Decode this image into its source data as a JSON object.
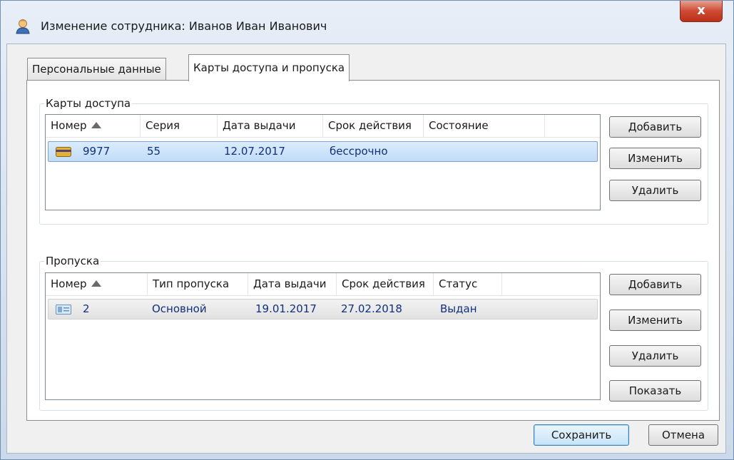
{
  "window": {
    "title": "Изменение сотрудника: Иванов Иван Иванович",
    "close_label": "x",
    "app_icon": "user-icon"
  },
  "tabs": [
    {
      "label": "Персональные данные",
      "selected": false
    },
    {
      "label": "Карты доступа и пропуска",
      "selected": true
    }
  ],
  "cards": {
    "group_label": "Карты доступа",
    "columns": [
      "Номер",
      "Серия",
      "Дата выдачи",
      "Срок действия",
      "Состояние"
    ],
    "sort_column": "Номер",
    "rows": [
      {
        "icon": "card-icon",
        "number": "9977",
        "series": "55",
        "issue_date": "12.07.2017",
        "validity": "бессрочно",
        "state": ""
      }
    ],
    "buttons": {
      "add": "Добавить",
      "edit": "Изменить",
      "delete": "Удалить"
    }
  },
  "passes": {
    "group_label": "Пропуска",
    "columns": [
      "Номер",
      "Тип пропуска",
      "Дата выдачи",
      "Срок действия",
      "Статус"
    ],
    "sort_column": "Номер",
    "rows": [
      {
        "icon": "pass-icon",
        "number": "2",
        "type": "Основной",
        "issue_date": "19.01.2017",
        "expiry": "27.02.2018",
        "status": "Выдан"
      }
    ],
    "buttons": {
      "add": "Добавить",
      "edit": "Изменить",
      "delete": "Удалить",
      "show": "Показать"
    }
  },
  "footer": {
    "save": "Сохранить",
    "cancel": "Отмена"
  },
  "colors": {
    "selection": "#cce4f8",
    "row_text": "#10307a",
    "close_button": "#c9432e"
  }
}
